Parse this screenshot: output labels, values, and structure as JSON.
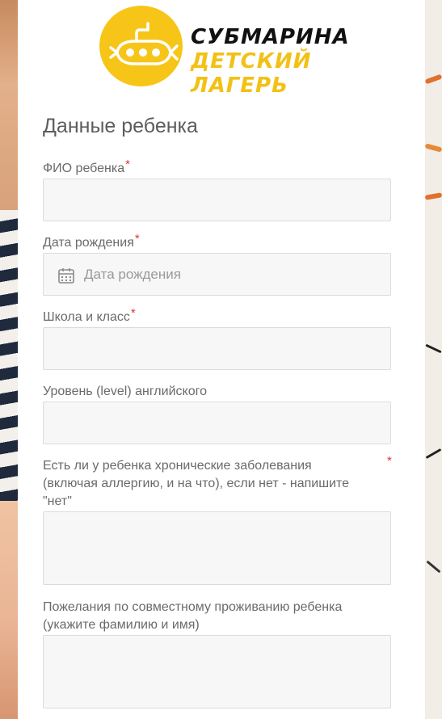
{
  "brand": {
    "name_line1": "СУБМАРИНА",
    "name_line2": "ДЕТСКИЙ ЛАГЕРЬ",
    "logo_icon": "submarine-icon",
    "accent_color": "#f7c517"
  },
  "form": {
    "section_title": "Данные ребенка",
    "required_mark": "*",
    "fields": [
      {
        "label": "ФИО ребенка",
        "required": true,
        "value": "",
        "placeholder": ""
      },
      {
        "label": "Дата рождения",
        "required": true,
        "value": "",
        "placeholder": "Дата рождения",
        "icon": "calendar-icon"
      },
      {
        "label": "Школа и класс",
        "required": true,
        "value": "",
        "placeholder": ""
      },
      {
        "label": "Уровень (level) английского",
        "required": false,
        "value": "",
        "placeholder": ""
      },
      {
        "label": "Есть ли у ребенка хронические заболевания (включая аллергию, и на что), если нет - напишите \"нет\"",
        "required": true,
        "value": "",
        "placeholder": ""
      },
      {
        "label": "Пожелания по совместному проживанию ребенка (укажите фамилию и имя)",
        "required": false,
        "value": "",
        "placeholder": ""
      }
    ]
  }
}
